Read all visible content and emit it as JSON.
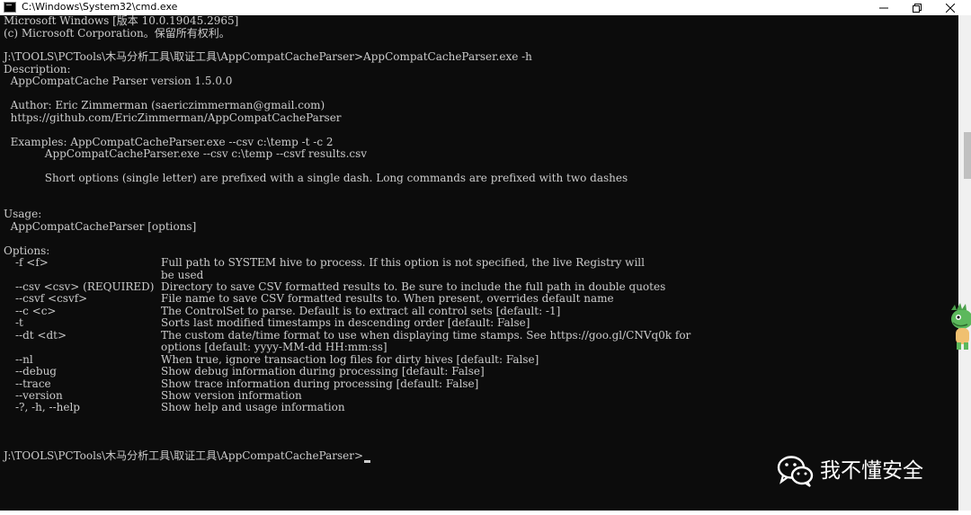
{
  "window": {
    "title": "C:\\Windows\\System32\\cmd.exe"
  },
  "console_lines": [
    {
      "text": "Microsoft Windows [版本 10.0.19045.2965]"
    },
    {
      "text": "(c) Microsoft Corporation。保留所有权利。"
    },
    {
      "text": ""
    },
    {
      "text": "J:\\TOOLS\\PCTools\\木马分析工具\\取证工具\\AppCompatCacheParser>AppCompatCacheParser.exe -h"
    },
    {
      "text": "Description:"
    },
    {
      "text": "  AppCompatCache Parser version 1.5.0.0"
    },
    {
      "text": ""
    },
    {
      "text": "  Author: Eric Zimmerman (saericzimmerman@gmail.com)"
    },
    {
      "text": "  https://github.com/EricZimmerman/AppCompatCacheParser"
    },
    {
      "text": ""
    },
    {
      "text": "  Examples: AppCompatCacheParser.exe --csv c:\\temp -t -c 2"
    },
    {
      "text": "            AppCompatCacheParser.exe --csv c:\\temp --csvf results.csv"
    },
    {
      "text": ""
    },
    {
      "text": "            Short options (single letter) are prefixed with a single dash. Long commands are prefixed with two dashes"
    },
    {
      "text": ""
    },
    {
      "text": ""
    },
    {
      "text": ""
    },
    {
      "text": "Usage:"
    },
    {
      "text": "  AppCompatCacheParser [options]"
    },
    {
      "text": ""
    },
    {
      "text": "Options:"
    }
  ],
  "options": [
    {
      "flag": "-f <f>",
      "desc": [
        "Full path to SYSTEM hive to process. If this option is not specified, the live Registry will",
        "be used"
      ]
    },
    {
      "flag": "--csv <csv> (REQUIRED)",
      "desc": [
        "Directory to save CSV formatted results to. Be sure to include the full path in double quotes"
      ]
    },
    {
      "flag": "--csvf <csvf>",
      "desc": [
        "File name to save CSV formatted results to. When present, overrides default name"
      ]
    },
    {
      "flag": "--c <c>",
      "desc": [
        "The ControlSet to parse. Default is to extract all control sets [default: -1]"
      ]
    },
    {
      "flag": "-t",
      "desc": [
        "Sorts last modified timestamps in descending order [default: False]"
      ]
    },
    {
      "flag": "--dt <dt>",
      "desc": [
        "The custom date/time format to use when displaying time stamps. See https://goo.gl/CNVq0k for",
        "options [default: yyyy-MM-dd HH:mm:ss]"
      ]
    },
    {
      "flag": "--nl",
      "desc": [
        "When true, ignore transaction log files for dirty hives [default: False]"
      ]
    },
    {
      "flag": "--debug",
      "desc": [
        "Show debug information during processing [default: False]"
      ]
    },
    {
      "flag": "--trace",
      "desc": [
        "Show trace information during processing [default: False]"
      ]
    },
    {
      "flag": "--version",
      "desc": [
        "Show version information"
      ]
    },
    {
      "flag": "-?, -h, --help",
      "desc": [
        "Show help and usage information"
      ]
    }
  ],
  "prompt": "J:\\TOOLS\\PCTools\\木马分析工具\\取证工具\\AppCompatCacheParser>",
  "watermark": "我不懂安全",
  "icons": {
    "app": "cmd-icon",
    "minimize": "minimize-icon",
    "maximize": "maximize-icon",
    "close": "close-icon",
    "watermark": "wechat-icon"
  },
  "colors": {
    "console_bg": "#0c0c0c",
    "console_text": "#cccccc",
    "titlebar_bg": "#ffffff"
  }
}
